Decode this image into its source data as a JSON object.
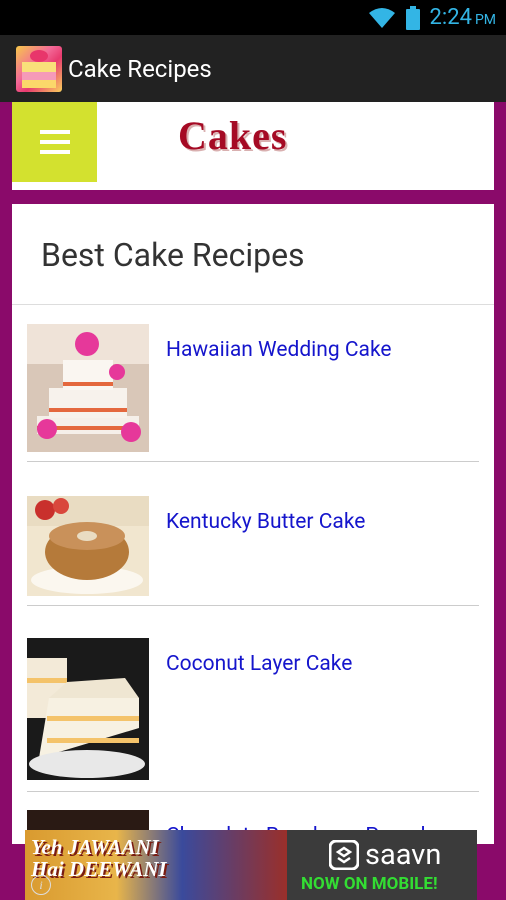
{
  "status_bar": {
    "time": "2:24",
    "ampm": "PM"
  },
  "action_bar": {
    "title": "Cake Recipes"
  },
  "header": {
    "logo_text": "Cakes"
  },
  "list": {
    "title": "Best Cake Recipes",
    "items": [
      {
        "title": "Hawaiian Wedding Cake"
      },
      {
        "title": "Kentucky Butter Cake"
      },
      {
        "title": "Coconut Layer Cake"
      },
      {
        "title": "Chocolate Raspberry Pound"
      }
    ]
  },
  "ad": {
    "movie_title_line1": "Yeh JAWAANI",
    "movie_title_line2": "Hai DEEWANI",
    "brand": "saavn",
    "tagline": "NOW ON MOBILE!"
  },
  "colors": {
    "accent_magenta": "#8a0a6a",
    "menu_button": "#d3e12f",
    "link_blue": "#1515cc",
    "status_blue": "#33b5e5"
  }
}
